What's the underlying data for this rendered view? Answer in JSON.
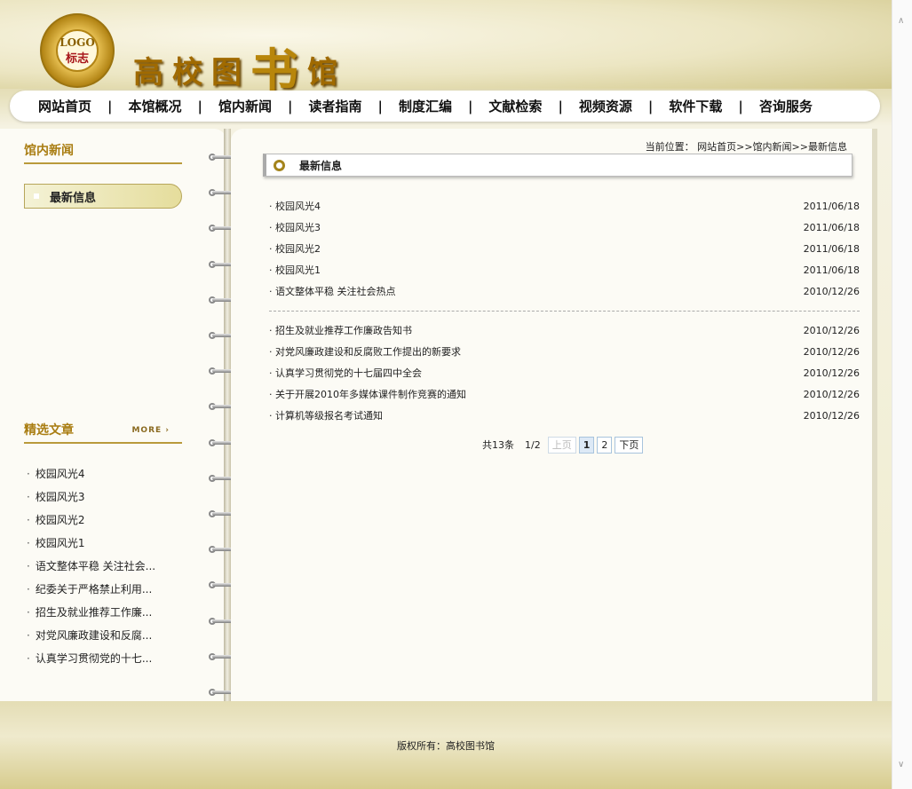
{
  "header": {
    "logo_text1": "LOGO",
    "logo_text2": "标志",
    "title_a": "高校图",
    "title_b": "书",
    "title_c": "馆"
  },
  "nav": {
    "items": [
      "网站首页",
      "本馆概况",
      "馆内新闻",
      "读者指南",
      "制度汇编",
      "文献检索",
      "视频资源",
      "软件下载",
      "咨询服务"
    ],
    "separator": "|"
  },
  "sidebar": {
    "news_title": "馆内新闻",
    "category": "最新信息",
    "featured_title": "精选文章",
    "more_label": "MORE ›",
    "featured": [
      "校园风光4",
      "校园风光3",
      "校园风光2",
      "校园风光1",
      "语文整体平稳 关注社会...",
      "纪委关于严格禁止利用...",
      "招生及就业推荐工作廉...",
      "对党风廉政建设和反腐...",
      "认真学习贯彻党的十七..."
    ]
  },
  "main": {
    "breadcrumb": "当前位置： 网站首页>>馆内新闻>>最新信息",
    "section_title": "最新信息",
    "list1": [
      {
        "title": "校园风光4",
        "date": "2011/06/18"
      },
      {
        "title": "校园风光3",
        "date": "2011/06/18"
      },
      {
        "title": "校园风光2",
        "date": "2011/06/18"
      },
      {
        "title": "校园风光1",
        "date": "2011/06/18"
      },
      {
        "title": "语文整体平稳 关注社会热点",
        "date": "2010/12/26"
      }
    ],
    "list2": [
      {
        "title": "招生及就业推荐工作廉政告知书",
        "date": "2010/12/26"
      },
      {
        "title": "对党风廉政建设和反腐败工作提出的新要求",
        "date": "2010/12/26"
      },
      {
        "title": "认真学习贯彻党的十七届四中全会",
        "date": "2010/12/26"
      },
      {
        "title": "关于开展2010年多媒体课件制作竞赛的通知",
        "date": "2010/12/26"
      },
      {
        "title": "计算机等级报名考试通知",
        "date": "2010/12/26"
      }
    ],
    "pager": {
      "total": "共13条",
      "page": "1/2",
      "prev": "上页",
      "p1": "1",
      "p2": "2",
      "next": "下页"
    }
  },
  "footer": {
    "copyright": "版权所有：高校图书馆"
  },
  "scrollbar": {
    "up": "∧",
    "down": "∨"
  }
}
